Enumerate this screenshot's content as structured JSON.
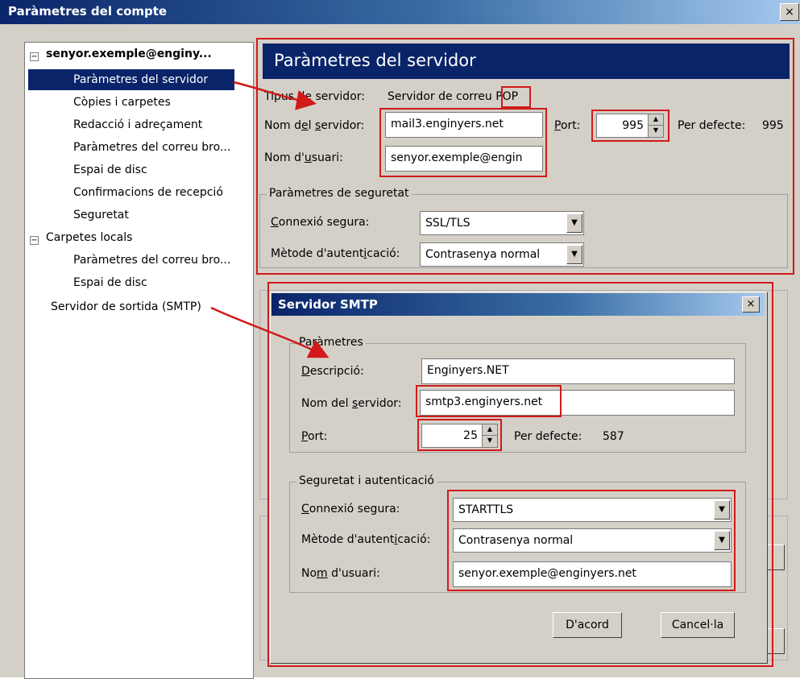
{
  "window": {
    "title": "Paràmetres del compte",
    "close": "×"
  },
  "tree": {
    "account": "senyor.exemple@enginy...",
    "account_items": [
      "Paràmetres del servidor",
      "Còpies i carpetes",
      "Redacció i adreçament",
      "Paràmetres del correu bro...",
      "Espai de disc",
      "Confirmacions de recepció",
      "Seguretat"
    ],
    "local": "Carpetes locals",
    "local_items": [
      "Paràmetres del correu bro...",
      "Espai de disc"
    ],
    "smtp": "Servidor de sortida (SMTP)"
  },
  "server": {
    "header": "Paràmetres del servidor",
    "type_label": "Tipus de servidor:",
    "type_value_prefix": "Servidor de correu ",
    "type_value_highlight": "POP",
    "server_name_label": "Nom del servidor:",
    "server_name_value": "mail3.enginyers.net",
    "port_label": "Port:",
    "port_value": "995",
    "default_label": "Per defecte:",
    "default_value": "995",
    "username_label": "Nom d'usuari:",
    "username_value": "senyor.exemple@engin",
    "security_group": "Paràmetres de seguretat",
    "conn_label": "Connexió segura:",
    "conn_value": "SSL/TLS",
    "auth_label": "Mètode d'autenticació:",
    "auth_value": "Contrasenya normal"
  },
  "dialog": {
    "title": "Servidor SMTP",
    "close": "×",
    "params_group": "Paràmetres",
    "desc_label": "Descripció:",
    "desc_value": "Enginyers.NET",
    "server_label": "Nom del servidor:",
    "server_value": "smtp3.enginyers.net",
    "port_label": "Port:",
    "port_value": "25",
    "default_label": "Per defecte:",
    "default_value": "587",
    "sec_group": "Seguretat i autenticació",
    "conn_label": "Connexió segura:",
    "conn_value": "STARTTLS",
    "auth_label": "Mètode d'autenticació:",
    "auth_value": "Contrasenya normal",
    "user_label": "Nom d'usuari:",
    "user_value": "senyor.exemple@enginyers.net",
    "ok": "D'acord",
    "cancel": "Cancel·la"
  },
  "annotation_color": "#d11a1a",
  "icons": {
    "spinner": "spinner-arrows-icon",
    "dropdown": "chevron-down-icon",
    "collapse": "collapse-icon"
  }
}
